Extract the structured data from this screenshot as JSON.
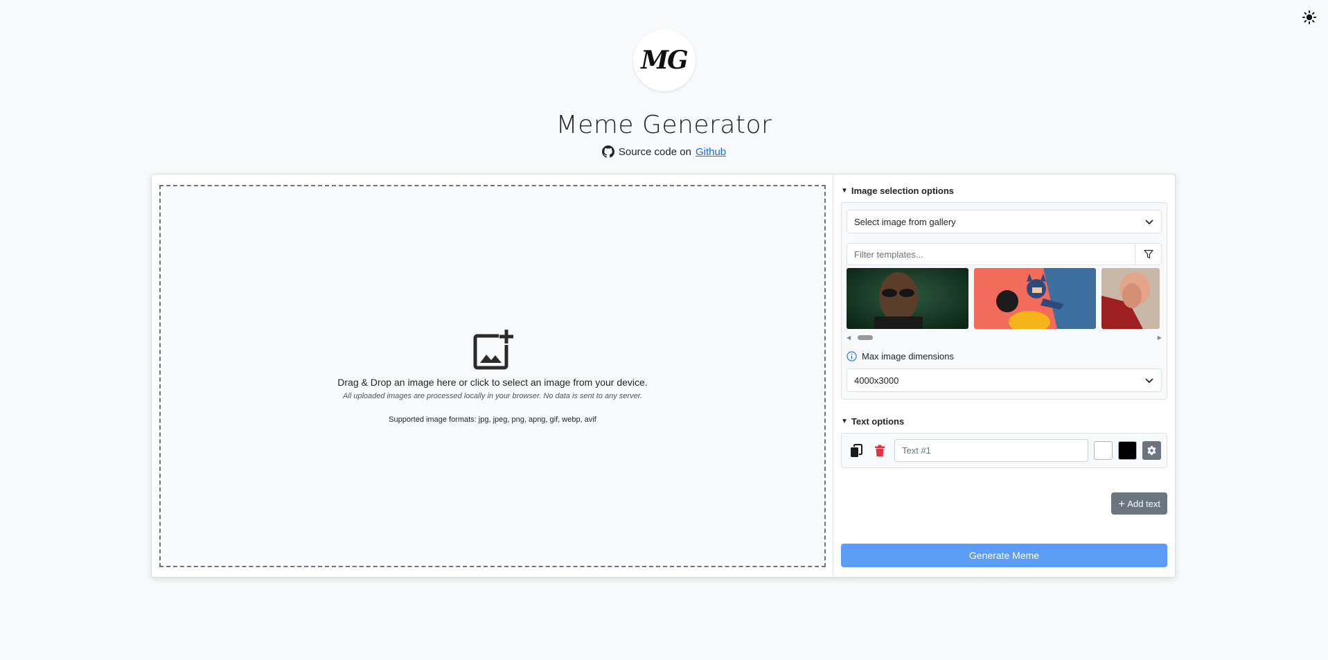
{
  "theme_toggle": {
    "icon": "sun-icon"
  },
  "header": {
    "logo_text": "MG",
    "title": "Meme Generator",
    "source_prefix": "Source code on",
    "source_link": "Github"
  },
  "dropzone": {
    "main_text": "Drag & Drop an image here or click to select an image from your device.",
    "privacy_note": "All uploaded images are processed locally in your browser. No data is sent to any server.",
    "formats_text": "Supported image formats: jpg, jpeg, png, apng, gif, webp, avif"
  },
  "image_options": {
    "section_title": "Image selection options",
    "source_select": "Select image from gallery",
    "filter_placeholder": "Filter templates...",
    "gallery": [
      {
        "name": "gallery-thumb-morpheus"
      },
      {
        "name": "gallery-thumb-batman-slap"
      },
      {
        "name": "gallery-thumb-facepalm"
      }
    ],
    "max_dim_label": "Max image dimensions",
    "max_dim_value": "4000x3000"
  },
  "text_options": {
    "section_title": "Text options",
    "text_placeholder": "Text #1",
    "fill_color": "#ffffff",
    "stroke_color": "#000000",
    "add_text_label": "Add text"
  },
  "generate_label": "Generate Meme",
  "colors": {
    "primary_button": "#5b9cf7",
    "secondary_button": "#6c757d",
    "delete_icon": "#dc3545",
    "link": "#0d6efd"
  }
}
